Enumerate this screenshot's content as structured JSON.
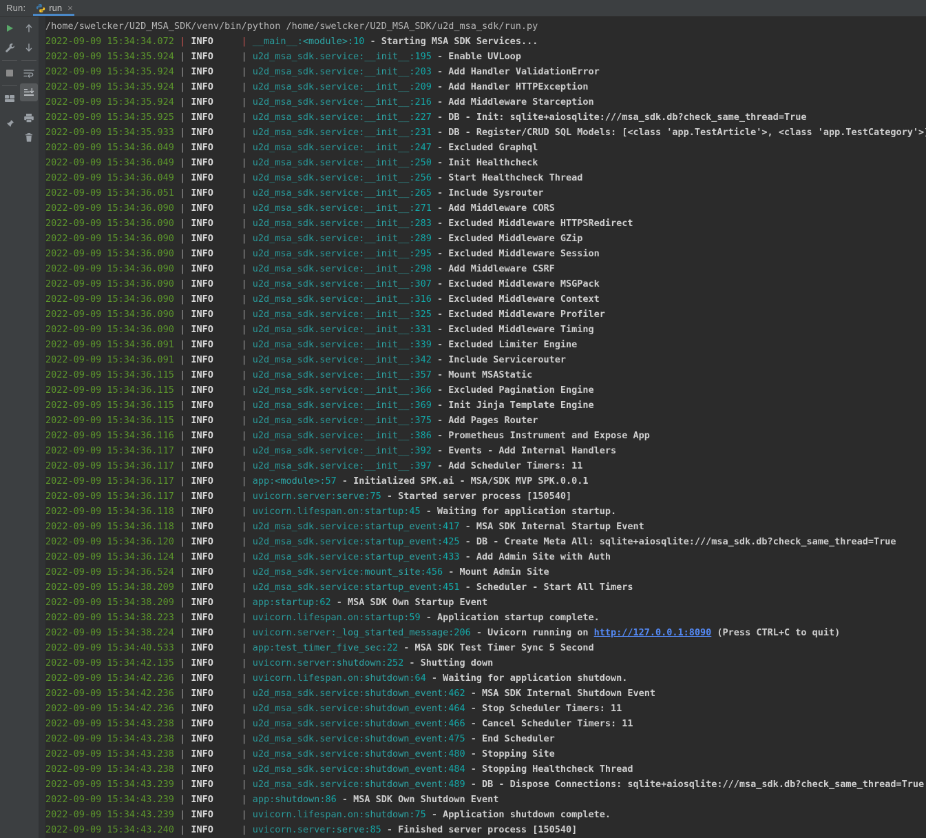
{
  "window": {
    "tool_window_label": "Run:",
    "background": "#2b2b2b",
    "toolbar_background": "#3c3f41",
    "accent": "#4a88c7"
  },
  "tabs": [
    {
      "label": "run",
      "icon": "python-icon",
      "close": "×",
      "active": true
    }
  ],
  "toolbar": {
    "left_column": [
      {
        "name": "run-button",
        "title": "Rerun"
      },
      {
        "name": "wrench-icon",
        "title": "Modify Run Configuration"
      },
      {
        "name": "stop-button",
        "title": "Stop"
      },
      {
        "name": "layout-icon",
        "title": "Show Tool Window Layout"
      },
      {
        "name": "pin-icon",
        "title": "Pin Tab"
      }
    ],
    "right_column": [
      {
        "name": "up-arrow-icon",
        "title": "Up the Stack Trace"
      },
      {
        "name": "down-arrow-icon",
        "title": "Down the Stack Trace"
      },
      {
        "name": "soft-wrap-icon",
        "title": "Soft-Wrap"
      },
      {
        "name": "scroll-to-end-icon",
        "title": "Scroll to End",
        "active": true
      },
      {
        "name": "print-icon",
        "title": "Print"
      },
      {
        "name": "trash-icon",
        "title": "Clear All"
      }
    ]
  },
  "console": {
    "command": "/home/swelcker/U2D_MSA_SDK/venv/bin/python /home/swelcker/U2D_MSA_SDK/u2d_msa_sdk/run.py",
    "level": "INFO",
    "colors": {
      "timestamp": "#5c962c",
      "level": "#dcdcdc",
      "module": "#299999",
      "function": "#2da6a6",
      "lineno": "#13a8a8",
      "message": "#cfcfcf",
      "separator": "#9b9b9b",
      "separator_first": "#c75450",
      "link": "#548af7"
    },
    "link_text": "http://127.0.0.1:8090",
    "entries": [
      {
        "ts": "2022-09-09 15:34:34.072",
        "first": true,
        "mod": "__main__",
        "fn": "<module>",
        "ln": "10",
        "msg": "Starting MSA SDK Services..."
      },
      {
        "ts": "2022-09-09 15:34:35.924",
        "mod": "u2d_msa_sdk.service",
        "fn": "__init__",
        "ln": "195",
        "msg": "Enable UVLoop"
      },
      {
        "ts": "2022-09-09 15:34:35.924",
        "mod": "u2d_msa_sdk.service",
        "fn": "__init__",
        "ln": "203",
        "msg": "Add Handler ValidationError"
      },
      {
        "ts": "2022-09-09 15:34:35.924",
        "mod": "u2d_msa_sdk.service",
        "fn": "__init__",
        "ln": "209",
        "msg": "Add Handler HTTPException"
      },
      {
        "ts": "2022-09-09 15:34:35.924",
        "mod": "u2d_msa_sdk.service",
        "fn": "__init__",
        "ln": "216",
        "msg": "Add Middleware Starception"
      },
      {
        "ts": "2022-09-09 15:34:35.925",
        "mod": "u2d_msa_sdk.service",
        "fn": "__init__",
        "ln": "227",
        "msg": "DB - Init: sqlite+aiosqlite:///msa_sdk.db?check_same_thread=True"
      },
      {
        "ts": "2022-09-09 15:34:35.933",
        "mod": "u2d_msa_sdk.service",
        "fn": "__init__",
        "ln": "231",
        "msg": "DB - Register/CRUD SQL Models: [<class 'app.TestArticle'>, <class 'app.TestCategory'>]"
      },
      {
        "ts": "2022-09-09 15:34:36.049",
        "mod": "u2d_msa_sdk.service",
        "fn": "__init__",
        "ln": "247",
        "msg": "Excluded Graphql"
      },
      {
        "ts": "2022-09-09 15:34:36.049",
        "mod": "u2d_msa_sdk.service",
        "fn": "__init__",
        "ln": "250",
        "msg": "Init Healthcheck"
      },
      {
        "ts": "2022-09-09 15:34:36.049",
        "mod": "u2d_msa_sdk.service",
        "fn": "__init__",
        "ln": "256",
        "msg": "Start Healthcheck Thread"
      },
      {
        "ts": "2022-09-09 15:34:36.051",
        "mod": "u2d_msa_sdk.service",
        "fn": "__init__",
        "ln": "265",
        "msg": "Include Sysrouter"
      },
      {
        "ts": "2022-09-09 15:34:36.090",
        "mod": "u2d_msa_sdk.service",
        "fn": "__init__",
        "ln": "271",
        "msg": "Add Middleware CORS"
      },
      {
        "ts": "2022-09-09 15:34:36.090",
        "mod": "u2d_msa_sdk.service",
        "fn": "__init__",
        "ln": "283",
        "msg": "Excluded Middleware HTTPSRedirect"
      },
      {
        "ts": "2022-09-09 15:34:36.090",
        "mod": "u2d_msa_sdk.service",
        "fn": "__init__",
        "ln": "289",
        "msg": "Excluded Middleware GZip"
      },
      {
        "ts": "2022-09-09 15:34:36.090",
        "mod": "u2d_msa_sdk.service",
        "fn": "__init__",
        "ln": "295",
        "msg": "Excluded Middleware Session"
      },
      {
        "ts": "2022-09-09 15:34:36.090",
        "mod": "u2d_msa_sdk.service",
        "fn": "__init__",
        "ln": "298",
        "msg": "Add Middleware CSRF"
      },
      {
        "ts": "2022-09-09 15:34:36.090",
        "mod": "u2d_msa_sdk.service",
        "fn": "__init__",
        "ln": "307",
        "msg": "Excluded Middleware MSGPack"
      },
      {
        "ts": "2022-09-09 15:34:36.090",
        "mod": "u2d_msa_sdk.service",
        "fn": "__init__",
        "ln": "316",
        "msg": "Excluded Middleware Context"
      },
      {
        "ts": "2022-09-09 15:34:36.090",
        "mod": "u2d_msa_sdk.service",
        "fn": "__init__",
        "ln": "325",
        "msg": "Excluded Middleware Profiler"
      },
      {
        "ts": "2022-09-09 15:34:36.090",
        "mod": "u2d_msa_sdk.service",
        "fn": "__init__",
        "ln": "331",
        "msg": "Excluded Middleware Timing"
      },
      {
        "ts": "2022-09-09 15:34:36.091",
        "mod": "u2d_msa_sdk.service",
        "fn": "__init__",
        "ln": "339",
        "msg": "Excluded Limiter Engine"
      },
      {
        "ts": "2022-09-09 15:34:36.091",
        "mod": "u2d_msa_sdk.service",
        "fn": "__init__",
        "ln": "342",
        "msg": "Include Servicerouter"
      },
      {
        "ts": "2022-09-09 15:34:36.115",
        "mod": "u2d_msa_sdk.service",
        "fn": "__init__",
        "ln": "357",
        "msg": "Mount MSAStatic"
      },
      {
        "ts": "2022-09-09 15:34:36.115",
        "mod": "u2d_msa_sdk.service",
        "fn": "__init__",
        "ln": "366",
        "msg": "Excluded Pagination Engine"
      },
      {
        "ts": "2022-09-09 15:34:36.115",
        "mod": "u2d_msa_sdk.service",
        "fn": "__init__",
        "ln": "369",
        "msg": "Init Jinja Template Engine"
      },
      {
        "ts": "2022-09-09 15:34:36.115",
        "mod": "u2d_msa_sdk.service",
        "fn": "__init__",
        "ln": "375",
        "msg": "Add Pages Router"
      },
      {
        "ts": "2022-09-09 15:34:36.116",
        "mod": "u2d_msa_sdk.service",
        "fn": "__init__",
        "ln": "386",
        "msg": "Prometheus Instrument and Expose App"
      },
      {
        "ts": "2022-09-09 15:34:36.117",
        "mod": "u2d_msa_sdk.service",
        "fn": "__init__",
        "ln": "392",
        "msg": "Events - Add Internal Handlers"
      },
      {
        "ts": "2022-09-09 15:34:36.117",
        "mod": "u2d_msa_sdk.service",
        "fn": "__init__",
        "ln": "397",
        "msg": "Add Scheduler Timers: 11"
      },
      {
        "ts": "2022-09-09 15:34:36.117",
        "mod": "app",
        "fn": "<module>",
        "ln": "57",
        "msg": "Initialized SPK.ai - MSA/SDK MVP SPK.0.0.1"
      },
      {
        "ts": "2022-09-09 15:34:36.117",
        "mod": "uvicorn.server",
        "fn": "serve",
        "ln": "75",
        "msg": "Started server process [150540]"
      },
      {
        "ts": "2022-09-09 15:34:36.118",
        "mod": "uvicorn.lifespan.on",
        "fn": "startup",
        "ln": "45",
        "msg": "Waiting for application startup."
      },
      {
        "ts": "2022-09-09 15:34:36.118",
        "mod": "u2d_msa_sdk.service",
        "fn": "startup_event",
        "ln": "417",
        "msg": "MSA SDK Internal Startup Event"
      },
      {
        "ts": "2022-09-09 15:34:36.120",
        "mod": "u2d_msa_sdk.service",
        "fn": "startup_event",
        "ln": "425",
        "msg": "DB - Create Meta All: sqlite+aiosqlite:///msa_sdk.db?check_same_thread=True"
      },
      {
        "ts": "2022-09-09 15:34:36.124",
        "mod": "u2d_msa_sdk.service",
        "fn": "startup_event",
        "ln": "433",
        "msg": "Add Admin Site with Auth"
      },
      {
        "ts": "2022-09-09 15:34:36.524",
        "mod": "u2d_msa_sdk.service",
        "fn": "mount_site",
        "ln": "456",
        "msg": "Mount Admin Site"
      },
      {
        "ts": "2022-09-09 15:34:38.209",
        "mod": "u2d_msa_sdk.service",
        "fn": "startup_event",
        "ln": "451",
        "msg": "Scheduler - Start All Timers"
      },
      {
        "ts": "2022-09-09 15:34:38.209",
        "mod": "app",
        "fn": "startup",
        "ln": "62",
        "msg": "MSA SDK Own Startup Event"
      },
      {
        "ts": "2022-09-09 15:34:38.223",
        "mod": "uvicorn.lifespan.on",
        "fn": "startup",
        "ln": "59",
        "msg": "Application startup complete."
      },
      {
        "ts": "2022-09-09 15:34:38.224",
        "mod": "uvicorn.server",
        "fn": "_log_started_message",
        "ln": "206",
        "msg_pre": "Uvicorn running on ",
        "link": "http://127.0.0.1:8090",
        "msg_post": " (Press CTRL+C to quit)"
      },
      {
        "ts": "2022-09-09 15:34:40.533",
        "mod": "app",
        "fn": "test_timer_five_sec",
        "ln": "22",
        "msg": "MSA SDK Test Timer Sync 5 Second"
      },
      {
        "ts": "2022-09-09 15:34:42.135",
        "mod": "uvicorn.server",
        "fn": "shutdown",
        "ln": "252",
        "msg": "Shutting down"
      },
      {
        "ts": "2022-09-09 15:34:42.236",
        "mod": "uvicorn.lifespan.on",
        "fn": "shutdown",
        "ln": "64",
        "msg": "Waiting for application shutdown."
      },
      {
        "ts": "2022-09-09 15:34:42.236",
        "mod": "u2d_msa_sdk.service",
        "fn": "shutdown_event",
        "ln": "462",
        "msg": "MSA SDK Internal Shutdown Event"
      },
      {
        "ts": "2022-09-09 15:34:42.236",
        "mod": "u2d_msa_sdk.service",
        "fn": "shutdown_event",
        "ln": "464",
        "msg": "Stop Scheduler Timers: 11"
      },
      {
        "ts": "2022-09-09 15:34:43.238",
        "mod": "u2d_msa_sdk.service",
        "fn": "shutdown_event",
        "ln": "466",
        "msg": "Cancel Scheduler Timers: 11"
      },
      {
        "ts": "2022-09-09 15:34:43.238",
        "mod": "u2d_msa_sdk.service",
        "fn": "shutdown_event",
        "ln": "475",
        "msg": "End Scheduler"
      },
      {
        "ts": "2022-09-09 15:34:43.238",
        "mod": "u2d_msa_sdk.service",
        "fn": "shutdown_event",
        "ln": "480",
        "msg": "Stopping Site"
      },
      {
        "ts": "2022-09-09 15:34:43.238",
        "mod": "u2d_msa_sdk.service",
        "fn": "shutdown_event",
        "ln": "484",
        "msg": "Stopping Healthcheck Thread"
      },
      {
        "ts": "2022-09-09 15:34:43.239",
        "mod": "u2d_msa_sdk.service",
        "fn": "shutdown_event",
        "ln": "489",
        "msg": "DB - Dispose Connections: sqlite+aiosqlite:///msa_sdk.db?check_same_thread=True"
      },
      {
        "ts": "2022-09-09 15:34:43.239",
        "mod": "app",
        "fn": "shutdown",
        "ln": "86",
        "msg": "MSA SDK Own Shutdown Event"
      },
      {
        "ts": "2022-09-09 15:34:43.239",
        "mod": "uvicorn.lifespan.on",
        "fn": "shutdown",
        "ln": "75",
        "msg": "Application shutdown complete."
      },
      {
        "ts": "2022-09-09 15:34:43.240",
        "mod": "uvicorn.server",
        "fn": "serve",
        "ln": "85",
        "msg": "Finished server process [150540]"
      }
    ]
  }
}
